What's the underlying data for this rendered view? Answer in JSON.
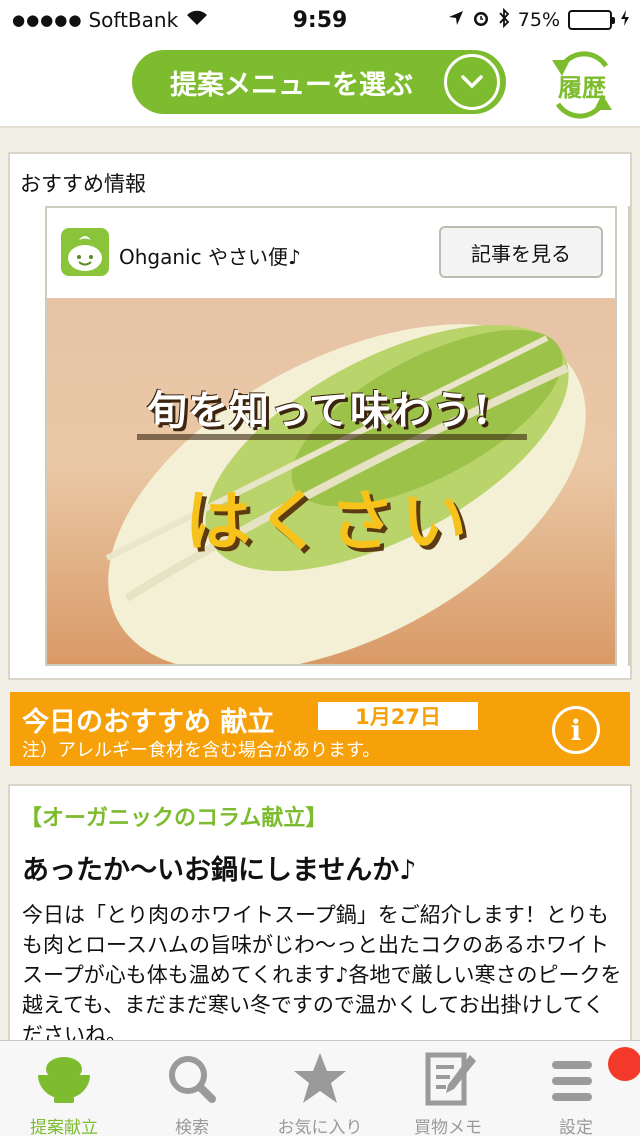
{
  "status_bar": {
    "carrier": "SoftBank",
    "time": "9:59",
    "battery": "75%",
    "battery_level": 0.75,
    "signal_dots": "●●●●●"
  },
  "header": {
    "menu_select_label": "提案メニューを選ぶ",
    "history_label": "履歴"
  },
  "recommendation": {
    "title": "おすすめ情報",
    "ad": {
      "brand": "Ohganic やさい便♪",
      "article_button": "記事を見る",
      "headline": "旬を知って味わう!",
      "vegetable": "はくさい"
    }
  },
  "today": {
    "title": "今日のおすすめ 献立",
    "date": "1月27日",
    "notice": "注）アレルギー食材を含む場合があります。",
    "info_icon": "i"
  },
  "column": {
    "tag": "【オーガニックのコラム献立】",
    "heading": "あったか〜いお鍋にしませんか♪",
    "body": "今日は「とり肉のホワイトスープ鍋」をご紹介します！とりもも肉とロースハムの旨味がじわ〜っと出たコクのあるホワイトスープが心も体も温めてくれます♪各地で厳しい寒さのピークを越えても、まだまだ寒い冬ですので温かくしてお出掛けしてくださいね。"
  },
  "tabs": [
    {
      "label": "提案献立",
      "icon": "rice-bowl-icon",
      "active": true
    },
    {
      "label": "検索",
      "icon": "search-icon",
      "active": false
    },
    {
      "label": "お気に入り",
      "icon": "star-icon",
      "active": false
    },
    {
      "label": "買物メモ",
      "icon": "memo-icon",
      "active": false
    },
    {
      "label": "設定",
      "icon": "settings-icon",
      "active": false,
      "badge": true
    }
  ],
  "colors": {
    "brand_green": "#7dbc2e",
    "accent_orange": "#f6a00a",
    "badge_red": "#f33a2a"
  }
}
